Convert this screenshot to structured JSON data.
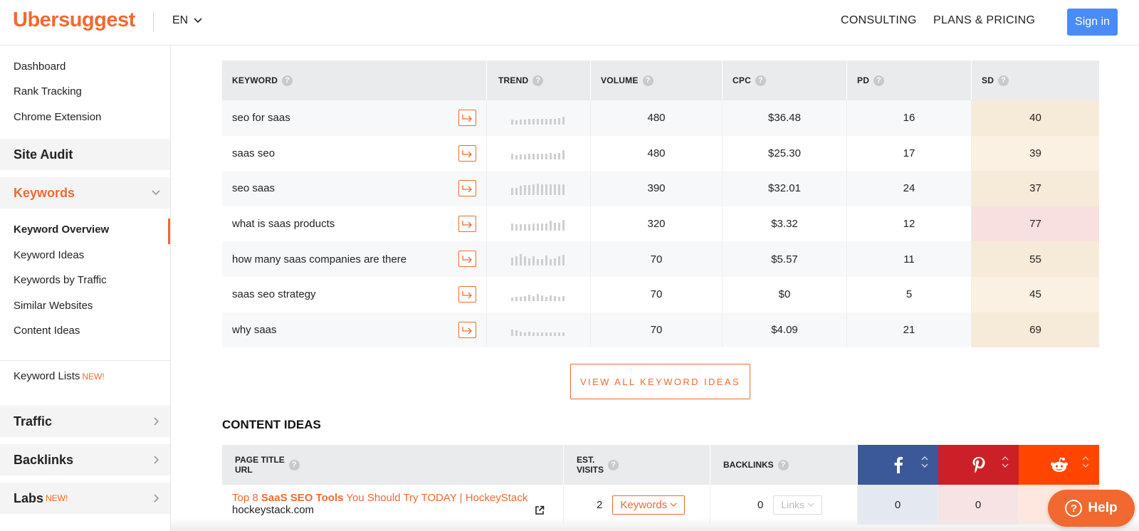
{
  "header": {
    "logo": "Ubersuggest",
    "lang": "EN",
    "consulting": "CONSULTING",
    "plans": "PLANS & PRICING",
    "signin": "Sign in"
  },
  "sidebar": {
    "top_links": [
      "Dashboard",
      "Rank Tracking",
      "Chrome Extension"
    ],
    "site_audit": "Site Audit",
    "keywords": "Keywords",
    "keyword_subitems": [
      "Keyword Overview",
      "Keyword Ideas",
      "Keywords by Traffic",
      "Similar Websites",
      "Content Ideas"
    ],
    "keyword_lists": "Keyword Lists",
    "new_badge": "NEW!",
    "traffic": "Traffic",
    "backlinks": "Backlinks",
    "labs": "Labs"
  },
  "keyword_table": {
    "headers": [
      "KEYWORD",
      "TREND",
      "VOLUME",
      "CPC",
      "PD",
      "SD"
    ],
    "rows": [
      {
        "keyword": "seo for saas",
        "volume": "480",
        "cpc": "$36.48",
        "pd": "16",
        "sd": "40",
        "sd_color": "#f6ead9",
        "trend": [
          6,
          5,
          6,
          6,
          7,
          7,
          7,
          7,
          7,
          7,
          7,
          8,
          10
        ]
      },
      {
        "keyword": "saas seo",
        "volume": "480",
        "cpc": "$25.30",
        "pd": "17",
        "sd": "39",
        "sd_color": "#fbf1e2",
        "trend": [
          7,
          5,
          6,
          6,
          7,
          7,
          7,
          7,
          7,
          8,
          7,
          8,
          11
        ]
      },
      {
        "keyword": "seo saas",
        "volume": "390",
        "cpc": "$32.01",
        "pd": "24",
        "sd": "37",
        "sd_color": "#f6ead9",
        "trend": [
          9,
          9,
          11,
          12,
          12,
          13,
          14,
          13,
          13,
          13,
          13,
          13,
          13
        ]
      },
      {
        "keyword": "what is saas products",
        "volume": "320",
        "cpc": "$3.32",
        "pd": "12",
        "sd": "77",
        "sd_color": "#f8e0e0",
        "trend": [
          9,
          8,
          8,
          8,
          8,
          9,
          9,
          9,
          9,
          12,
          10,
          10,
          13
        ]
      },
      {
        "keyword": "how many saas companies are there",
        "volume": "70",
        "cpc": "$5.57",
        "pd": "11",
        "sd": "55",
        "sd_color": "#f6ead9",
        "trend": [
          10,
          11,
          14,
          11,
          9,
          11,
          8,
          8,
          12,
          8,
          9,
          11,
          13
        ]
      },
      {
        "keyword": "saas seo strategy",
        "volume": "70",
        "cpc": "$0",
        "pd": "5",
        "sd": "45",
        "sd_color": "#fbf1e2",
        "trend": [
          4,
          5,
          5,
          6,
          8,
          6,
          9,
          7,
          5,
          7,
          6,
          5,
          6
        ]
      },
      {
        "keyword": "why saas",
        "volume": "70",
        "cpc": "$4.09",
        "pd": "21",
        "sd": "69",
        "sd_color": "#f6ead9",
        "trend": [
          8,
          7,
          5,
          4,
          5,
          4,
          4,
          4,
          4,
          4,
          4,
          4,
          4
        ]
      }
    ]
  },
  "view_all": "VIEW ALL KEYWORD IDEAS",
  "content_ideas": {
    "title": "CONTENT IDEAS",
    "headers": {
      "page_title": "PAGE TITLE",
      "url": "URL",
      "est": "EST.",
      "visits": "VISITS",
      "backlinks": "BACKLINKS"
    },
    "row": {
      "title_pre": "Top 8 ",
      "title_bold": "SaaS SEO Tools",
      "title_post": " You Should Try TODAY | HockeyStack",
      "url": "hockeystack.com",
      "visits": "2",
      "keywords_btn": "Keywords",
      "backlinks": "0",
      "links_btn": "Links",
      "facebook": "0",
      "pinterest": "0"
    },
    "social_colors": {
      "facebook": "#3b5998",
      "pinterest": "#cb2027",
      "reddit": "#ff4500"
    }
  },
  "help": "Help",
  "colors": {
    "accent": "#f16930",
    "signin": "#4a8cf7"
  }
}
